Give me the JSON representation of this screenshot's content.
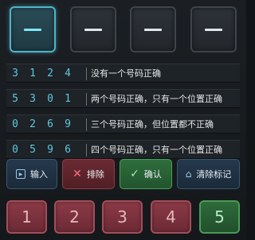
{
  "slots": [
    {
      "value": "—",
      "active": true
    },
    {
      "value": "—",
      "active": false
    },
    {
      "value": "—",
      "active": false
    },
    {
      "value": "—",
      "active": false
    }
  ],
  "clues": [
    {
      "digits": [
        "3",
        "1",
        "2",
        "4"
      ],
      "text": "没有一个号码正确"
    },
    {
      "digits": [
        "5",
        "3",
        "0",
        "1"
      ],
      "text": "两个号码正确，只有一个位置正确"
    },
    {
      "digits": [
        "0",
        "2",
        "6",
        "9"
      ],
      "text": "三个号码正确，但位置都不正确"
    },
    {
      "digits": [
        "0",
        "5",
        "9",
        "6"
      ],
      "text": "四个号码正确，只有一个位置正确"
    }
  ],
  "actions": {
    "input_label": "输入",
    "exclude_label": "排除",
    "confirm_label": "确认",
    "clear_label": "清除标记"
  },
  "numpad": [
    "1",
    "2",
    "3",
    "4",
    "5"
  ],
  "colors": {
    "digit": "#5fc7e0",
    "active_slot": "#4fb4c8",
    "num_red": "#8b3a46",
    "num_green": "#2e6b3a"
  }
}
